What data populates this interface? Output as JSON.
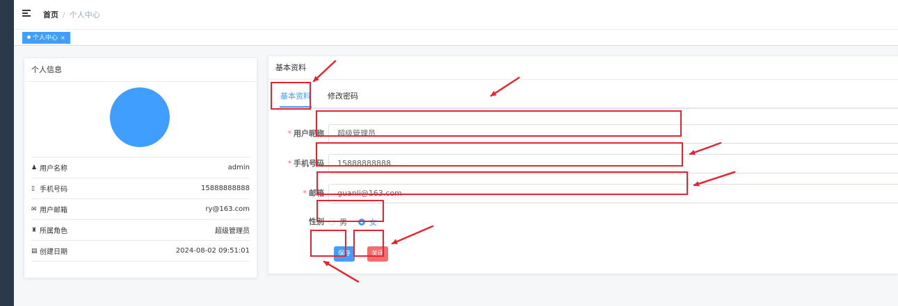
{
  "breadcrumb": {
    "home": "首页",
    "separator": "/",
    "current": "个人中心"
  },
  "tags_view": {
    "active_tag": "个人中心",
    "close": "×"
  },
  "profile_card": {
    "title": "个人信息",
    "rows": [
      {
        "icon": "user-icon",
        "label": "用户名称",
        "value": "admin"
      },
      {
        "icon": "phone-icon",
        "label": "手机号码",
        "value": "15888888888"
      },
      {
        "icon": "email-icon",
        "label": "用户邮箱",
        "value": "ry@163.com"
      },
      {
        "icon": "role-icon",
        "label": "所属角色",
        "value": "超级管理员"
      },
      {
        "icon": "calendar-icon",
        "label": "创建日期",
        "value": "2024-08-02 09:51:01"
      }
    ]
  },
  "basic_card": {
    "title": "基本资料",
    "tabs": {
      "basic": "基本资料",
      "password": "修改密码"
    },
    "form": {
      "nickname": {
        "label": "用户昵称",
        "value": "超级管理员"
      },
      "phone": {
        "label": "手机号码",
        "value": "15888888888"
      },
      "email": {
        "label": "邮箱",
        "value": "guanli@163.com"
      },
      "gender": {
        "label": "性别",
        "options": [
          "男",
          "女"
        ],
        "selected": "女"
      }
    },
    "buttons": {
      "save": "保存",
      "close": "关闭"
    }
  },
  "colors": {
    "primary": "#409eff",
    "danger": "#f56c6c",
    "annotation": "#e8232f",
    "sidebar": "#2b3a4a"
  }
}
